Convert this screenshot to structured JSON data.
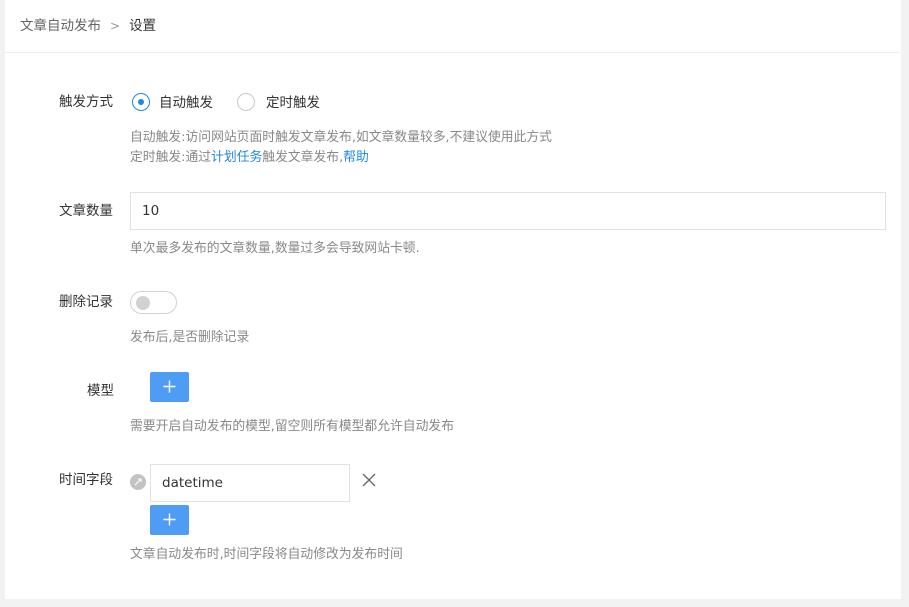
{
  "breadcrumb": {
    "parent": "文章自动发布",
    "separator": ">",
    "current": "设置"
  },
  "trigger": {
    "label": "触发方式",
    "options": [
      {
        "label": "自动触发",
        "selected": true
      },
      {
        "label": "定时触发",
        "selected": false
      }
    ],
    "help_line1": "自动触发:访问网站页面时触发文章发布,如文章数量较多,不建议使用此方式",
    "help_line2_prefix": "定时触发:通过",
    "help_line2_link": "计划任务",
    "help_line2_mid": "触发文章发布,",
    "help_line2_link2": "帮助"
  },
  "count": {
    "label": "文章数量",
    "value": "10",
    "help": "单次最多发布的文章数量,数量过多会导致网站卡顿."
  },
  "delete_record": {
    "label": "删除记录",
    "enabled": false,
    "help": "发布后,是否删除记录"
  },
  "model": {
    "label": "模型",
    "help": "需要开启自动发布的模型,留空则所有模型都允许自动发布"
  },
  "time_field": {
    "label": "时间字段",
    "items": [
      {
        "value": "datetime"
      }
    ],
    "help": "文章自动发布时,时间字段将自动修改为发布时间"
  },
  "colors": {
    "accent": "#1e88e5",
    "button": "#4e9cf4"
  }
}
